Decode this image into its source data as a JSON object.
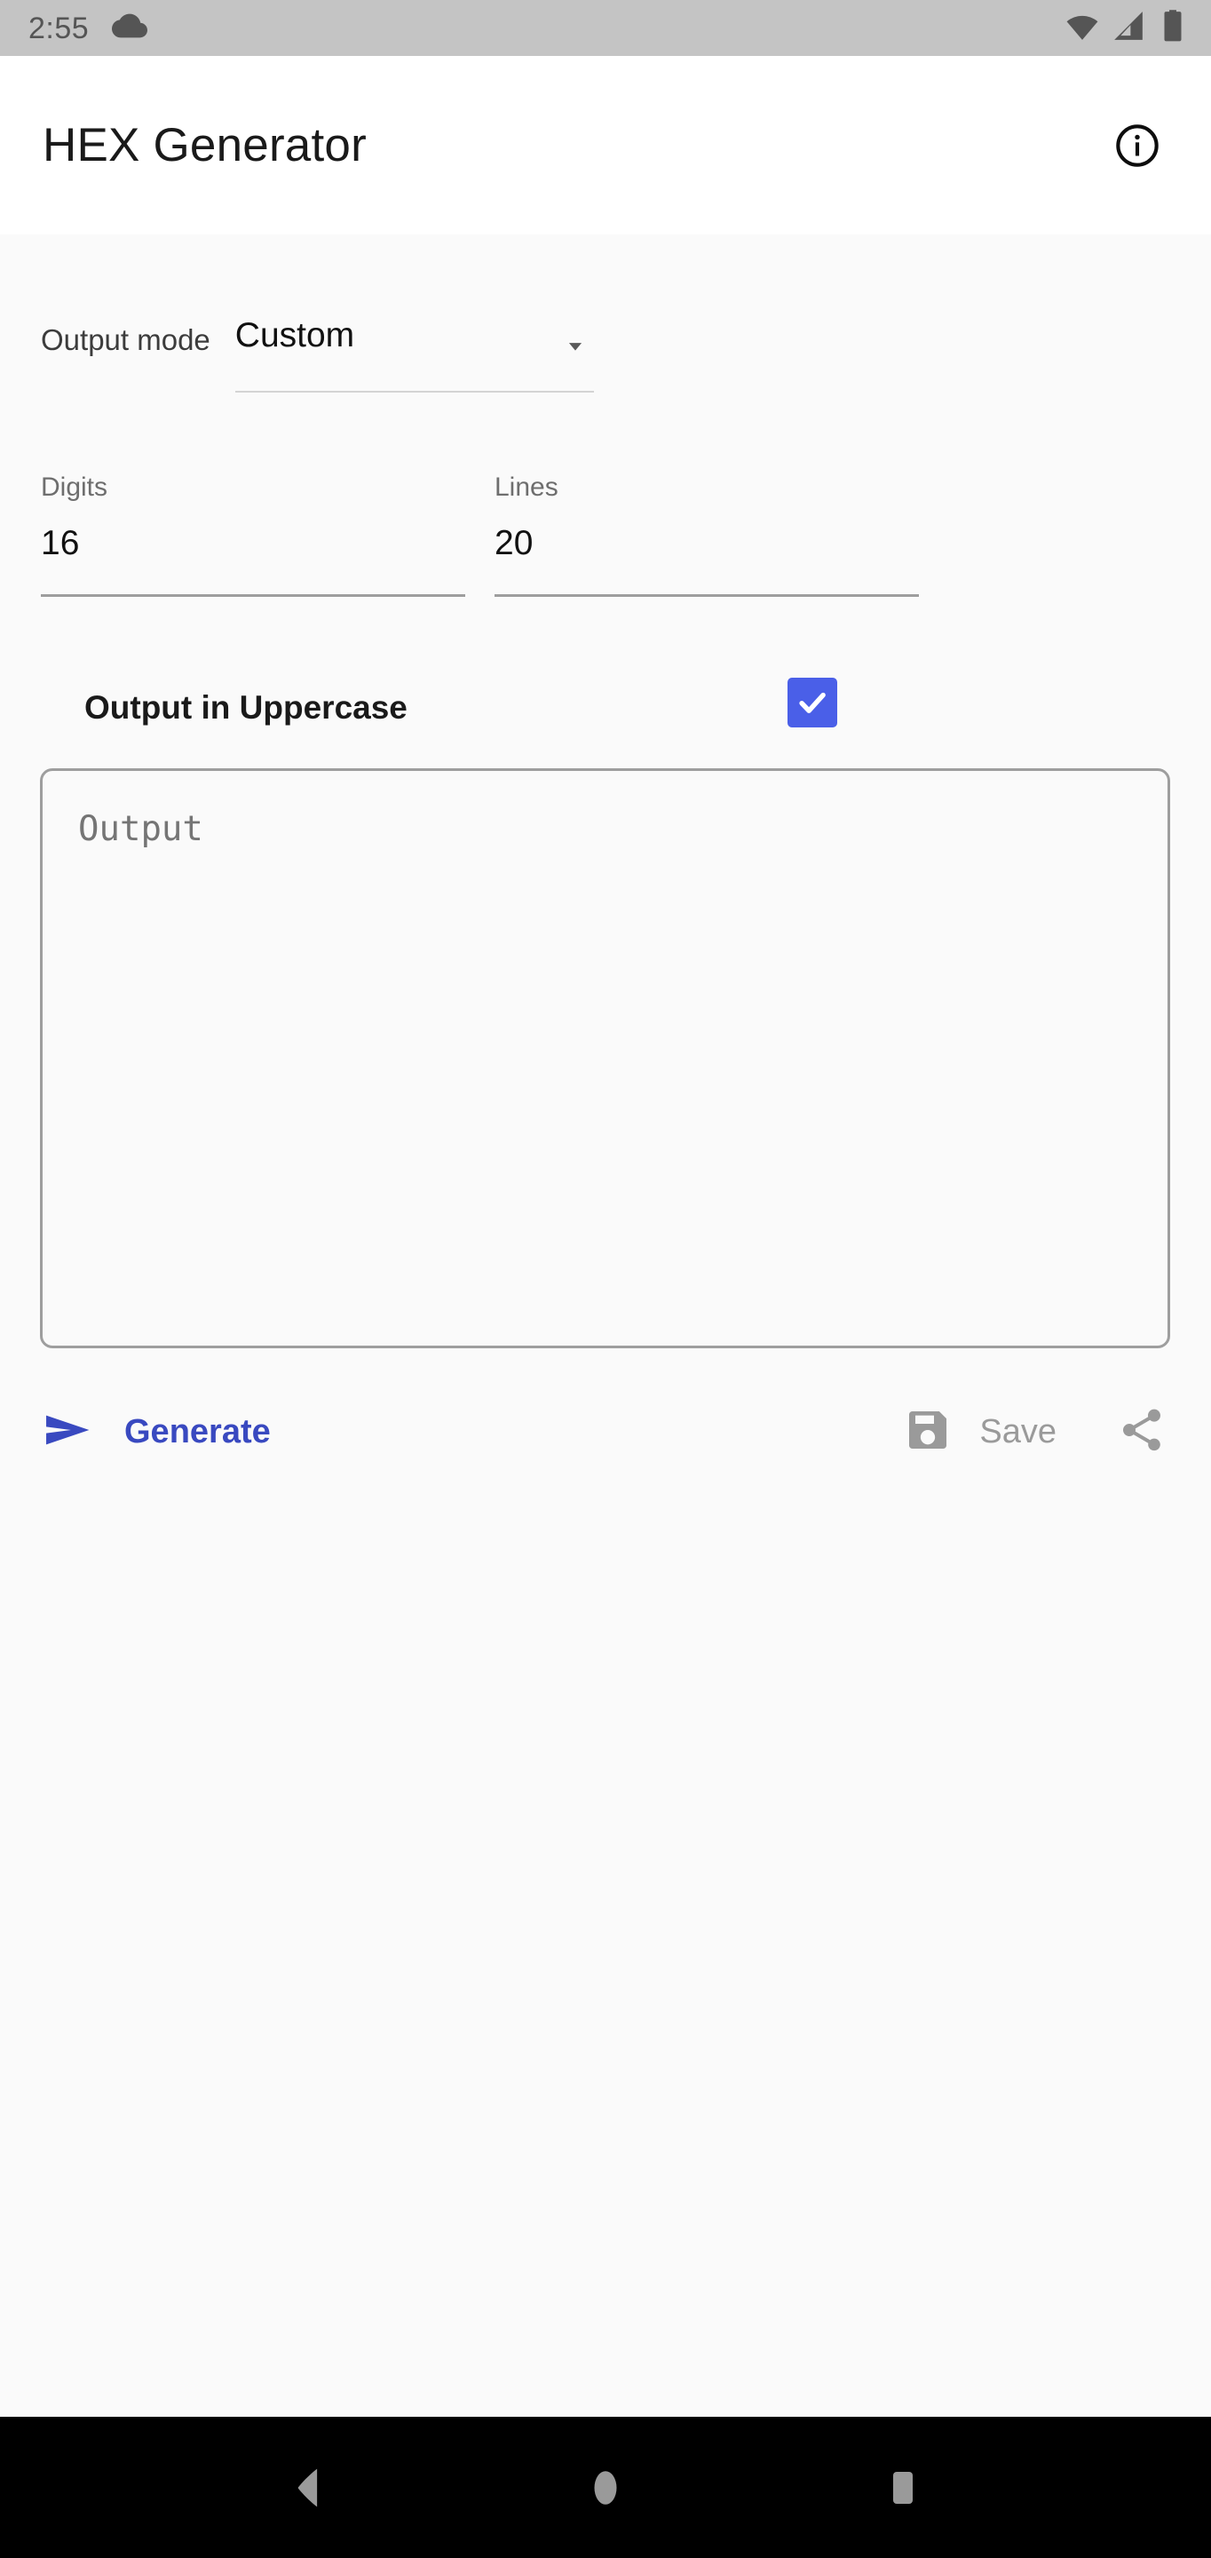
{
  "status_bar": {
    "time": "2:55",
    "cloud_icon": "cloud-icon",
    "wifi_icon": "wifi-icon",
    "signal_icon": "signal-icon",
    "battery_icon": "battery-icon",
    "background_color": "#C4C4C4"
  },
  "app_bar": {
    "title": "HEX Generator",
    "info_icon": "info-icon",
    "background_color": "#FFFFFF"
  },
  "form": {
    "output_mode": {
      "label": "Output mode",
      "value": "Custom",
      "caret_icon": "chevron-down-icon"
    },
    "digits": {
      "label": "Digits",
      "value": "16"
    },
    "lines": {
      "label": "Lines",
      "value": "20"
    },
    "uppercase": {
      "label": "Output in Uppercase",
      "checked": true,
      "accent_color": "#4A5FE8",
      "check_icon": "checkmark-icon"
    }
  },
  "output": {
    "placeholder": "Output",
    "value": ""
  },
  "actions": {
    "generate": {
      "label": "Generate",
      "icon": "send-icon",
      "color": "#3949C0"
    },
    "save": {
      "label": "Save",
      "icon": "floppy-disk-icon",
      "color": "#9A9A9A"
    },
    "share": {
      "icon": "share-icon",
      "color": "#9A9A9A"
    }
  },
  "nav_bar": {
    "back": "back-triangle-icon",
    "home": "home-circle-icon",
    "recents": "recents-square-icon",
    "background_color": "#000000"
  }
}
